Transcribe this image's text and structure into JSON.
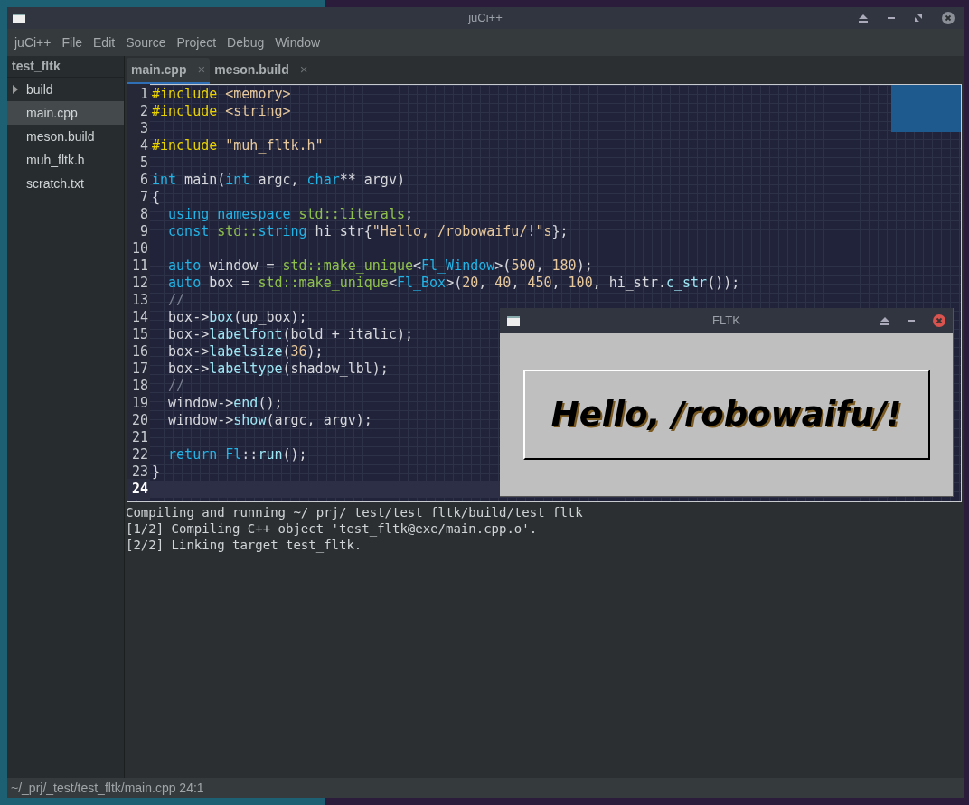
{
  "window": {
    "title": "juCi++"
  },
  "menu": [
    "juCi++",
    "File",
    "Edit",
    "Source",
    "Project",
    "Debug",
    "Window"
  ],
  "sidebar": {
    "project": "test_fltk",
    "items": [
      {
        "label": "build",
        "kind": "folder",
        "expanded": false,
        "selected": false
      },
      {
        "label": "main.cpp",
        "kind": "file",
        "selected": true
      },
      {
        "label": "meson.build",
        "kind": "file",
        "selected": false
      },
      {
        "label": "muh_fltk.h",
        "kind": "file",
        "selected": false
      },
      {
        "label": "scratch.txt",
        "kind": "file",
        "selected": false
      }
    ]
  },
  "tabs": [
    {
      "label": "main.cpp",
      "close": "×",
      "selected": true
    },
    {
      "label": "meson.build",
      "close": "×",
      "selected": false
    }
  ],
  "editor": {
    "lines": [
      {
        "number": "1",
        "tokens": [
          {
            "kind": "pre",
            "text": "#include"
          },
          {
            "kind": "str",
            "text": " <memory>"
          }
        ]
      },
      {
        "number": "2",
        "tokens": [
          {
            "kind": "pre",
            "text": "#include"
          },
          {
            "kind": "str",
            "text": " <string>"
          }
        ]
      },
      {
        "number": "3"
      },
      {
        "number": "4",
        "tokens": [
          {
            "kind": "pre",
            "text": "#include"
          },
          {
            "kind": "str",
            "text": " \"muh_fltk.h\""
          }
        ]
      },
      {
        "number": "5"
      },
      {
        "number": "6",
        "tokens": [
          {
            "kind": "kw",
            "text": "int"
          },
          {
            "kind": "plain",
            "text": " main("
          },
          {
            "kind": "kw",
            "text": "int"
          },
          {
            "kind": "plain",
            "text": " argc, "
          },
          {
            "kind": "kw",
            "text": "char"
          },
          {
            "kind": "plain",
            "text": "** argv)"
          }
        ]
      },
      {
        "number": "7",
        "tokens": [
          {
            "kind": "plain",
            "text": "{"
          }
        ]
      },
      {
        "number": "8",
        "tokens": [
          {
            "kind": "kw",
            "text": "  using namespace"
          },
          {
            "kind": "ns",
            "text": " std::literals"
          },
          {
            "kind": "plain",
            "text": ";"
          }
        ]
      },
      {
        "number": "9",
        "tokens": [
          {
            "kind": "kw",
            "text": "  const"
          },
          {
            "kind": "ns",
            "text": " std::"
          },
          {
            "kind": "kw",
            "text": "string"
          },
          {
            "kind": "plain",
            "text": " hi_str{"
          },
          {
            "kind": "str",
            "text": "\"Hello, /robowaifu/!\"s"
          },
          {
            "kind": "plain",
            "text": "};"
          }
        ]
      },
      {
        "number": "10"
      },
      {
        "number": "11",
        "tokens": [
          {
            "kind": "kw",
            "text": "  auto"
          },
          {
            "kind": "plain",
            "text": " window = "
          },
          {
            "kind": "ns",
            "text": "std::make_unique"
          },
          {
            "kind": "plain",
            "text": "<"
          },
          {
            "kind": "kw",
            "text": "Fl_Window"
          },
          {
            "kind": "plain",
            "text": ">("
          },
          {
            "kind": "str",
            "text": "500"
          },
          {
            "kind": "plain",
            "text": ", "
          },
          {
            "kind": "str",
            "text": "180"
          },
          {
            "kind": "plain",
            "text": ");"
          }
        ]
      },
      {
        "number": "12",
        "tokens": [
          {
            "kind": "kw",
            "text": "  auto"
          },
          {
            "kind": "plain",
            "text": " box = "
          },
          {
            "kind": "ns",
            "text": "std::make_unique"
          },
          {
            "kind": "plain",
            "text": "<"
          },
          {
            "kind": "kw",
            "text": "Fl_Box"
          },
          {
            "kind": "plain",
            "text": ">("
          },
          {
            "kind": "str",
            "text": "20"
          },
          {
            "kind": "plain",
            "text": ", "
          },
          {
            "kind": "str",
            "text": "40"
          },
          {
            "kind": "plain",
            "text": ", "
          },
          {
            "kind": "str",
            "text": "450"
          },
          {
            "kind": "plain",
            "text": ", "
          },
          {
            "kind": "str",
            "text": "100"
          },
          {
            "kind": "plain",
            "text": ", hi_str."
          },
          {
            "kind": "call",
            "text": "c_str"
          },
          {
            "kind": "plain",
            "text": "());"
          }
        ]
      },
      {
        "number": "13",
        "tokens": [
          {
            "kind": "comment",
            "text": "  //"
          }
        ]
      },
      {
        "number": "14",
        "tokens": [
          {
            "kind": "plain",
            "text": "  box->"
          },
          {
            "kind": "call",
            "text": "box"
          },
          {
            "kind": "plain",
            "text": "(up_box);"
          }
        ]
      },
      {
        "number": "15",
        "tokens": [
          {
            "kind": "plain",
            "text": "  box->"
          },
          {
            "kind": "call",
            "text": "labelfont"
          },
          {
            "kind": "plain",
            "text": "(bold + italic);"
          }
        ]
      },
      {
        "number": "16",
        "tokens": [
          {
            "kind": "plain",
            "text": "  box->"
          },
          {
            "kind": "call",
            "text": "labelsize"
          },
          {
            "kind": "plain",
            "text": "("
          },
          {
            "kind": "str",
            "text": "36"
          },
          {
            "kind": "plain",
            "text": ");"
          }
        ]
      },
      {
        "number": "17",
        "tokens": [
          {
            "kind": "plain",
            "text": "  box->"
          },
          {
            "kind": "call",
            "text": "labeltype"
          },
          {
            "kind": "plain",
            "text": "(shadow_lbl);"
          }
        ]
      },
      {
        "number": "18",
        "tokens": [
          {
            "kind": "comment",
            "text": "  //"
          }
        ]
      },
      {
        "number": "19",
        "tokens": [
          {
            "kind": "plain",
            "text": "  window->"
          },
          {
            "kind": "call",
            "text": "end"
          },
          {
            "kind": "plain",
            "text": "();"
          }
        ]
      },
      {
        "number": "20",
        "tokens": [
          {
            "kind": "plain",
            "text": "  window->"
          },
          {
            "kind": "call",
            "text": "show"
          },
          {
            "kind": "plain",
            "text": "(argc, argv);"
          }
        ]
      },
      {
        "number": "21"
      },
      {
        "number": "22",
        "tokens": [
          {
            "kind": "kw",
            "text": "  return Fl"
          },
          {
            "kind": "plain",
            "text": "::"
          },
          {
            "kind": "call",
            "text": "run"
          },
          {
            "kind": "plain",
            "text": "();"
          }
        ]
      },
      {
        "number": "23",
        "tokens": [
          {
            "kind": "plain",
            "text": "}"
          }
        ]
      },
      {
        "number": "24",
        "current": true
      }
    ]
  },
  "output": [
    "Compiling and running ~/_prj/_test/test_fltk/build/test_fltk",
    "[1/2] Compiling C++ object 'test_fltk@exe/main.cpp.o'.",
    "[2/2] Linking target test_fltk."
  ],
  "status_bar": "~/_prj/_test/test_fltk/main.cpp 24:1",
  "fltk_window": {
    "title": "FLTK",
    "label": "Hello, /robowaifu/!"
  }
}
